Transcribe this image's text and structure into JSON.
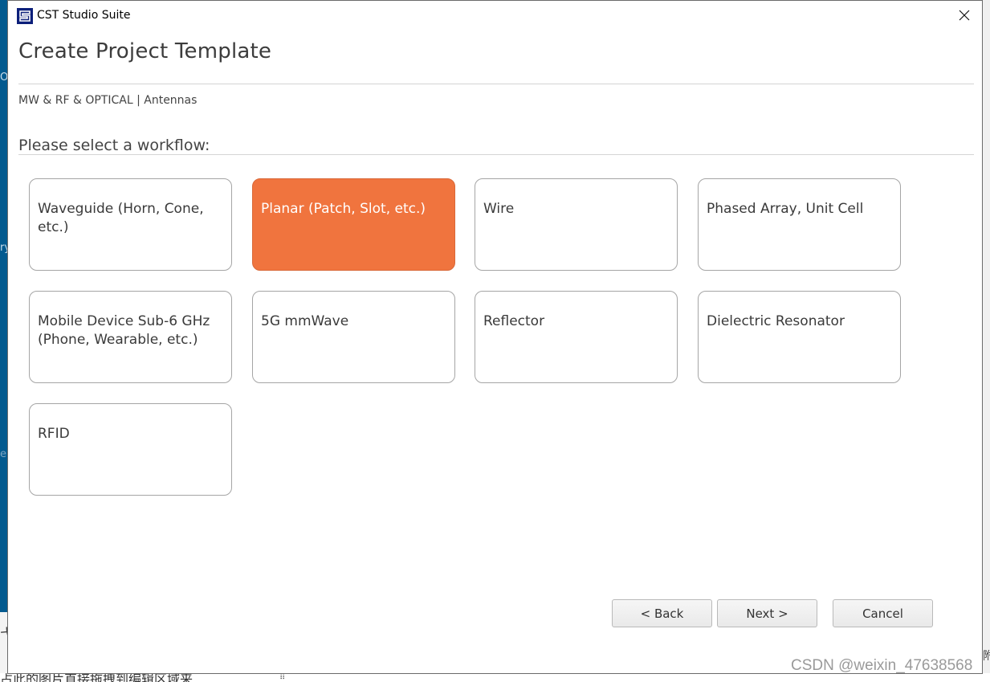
{
  "window": {
    "app_title": "CST Studio Suite",
    "close_icon": "close-icon",
    "app_icon": "cst-logo-icon"
  },
  "header": {
    "title": "Create Project Template",
    "breadcrumb": "MW & RF & OPTICAL | Antennas"
  },
  "workflow": {
    "prompt": "Please select a workflow:",
    "selected": "Planar (Patch, Slot, etc.)",
    "accent_color": "#f0743e",
    "tiles": [
      {
        "label": "Waveguide (Horn, Cone, etc.)",
        "selected": false
      },
      {
        "label": "Planar (Patch, Slot, etc.)",
        "selected": true
      },
      {
        "label": "Wire",
        "selected": false
      },
      {
        "label": "Phased Array, Unit Cell",
        "selected": false
      },
      {
        "label": "Mobile Device Sub-6 GHz (Phone, Wearable, etc.)",
        "selected": false
      },
      {
        "label": "5G mmWave",
        "selected": false
      },
      {
        "label": "Reflector",
        "selected": false
      },
      {
        "label": "Dielectric Resonator",
        "selected": false
      },
      {
        "label": "RFID",
        "selected": false
      }
    ]
  },
  "footer": {
    "back_label": "< Back",
    "next_label": "Next >",
    "cancel_label": "Cancel"
  },
  "background": {
    "left_hints": [
      "O",
      "ry",
      "e"
    ],
    "bottom_text": "占此的图片直接拖拽到编辑区域来",
    "bottom_left_char": "弋",
    "right_char": "附"
  },
  "watermark": "CSDN @weixin_47638568"
}
